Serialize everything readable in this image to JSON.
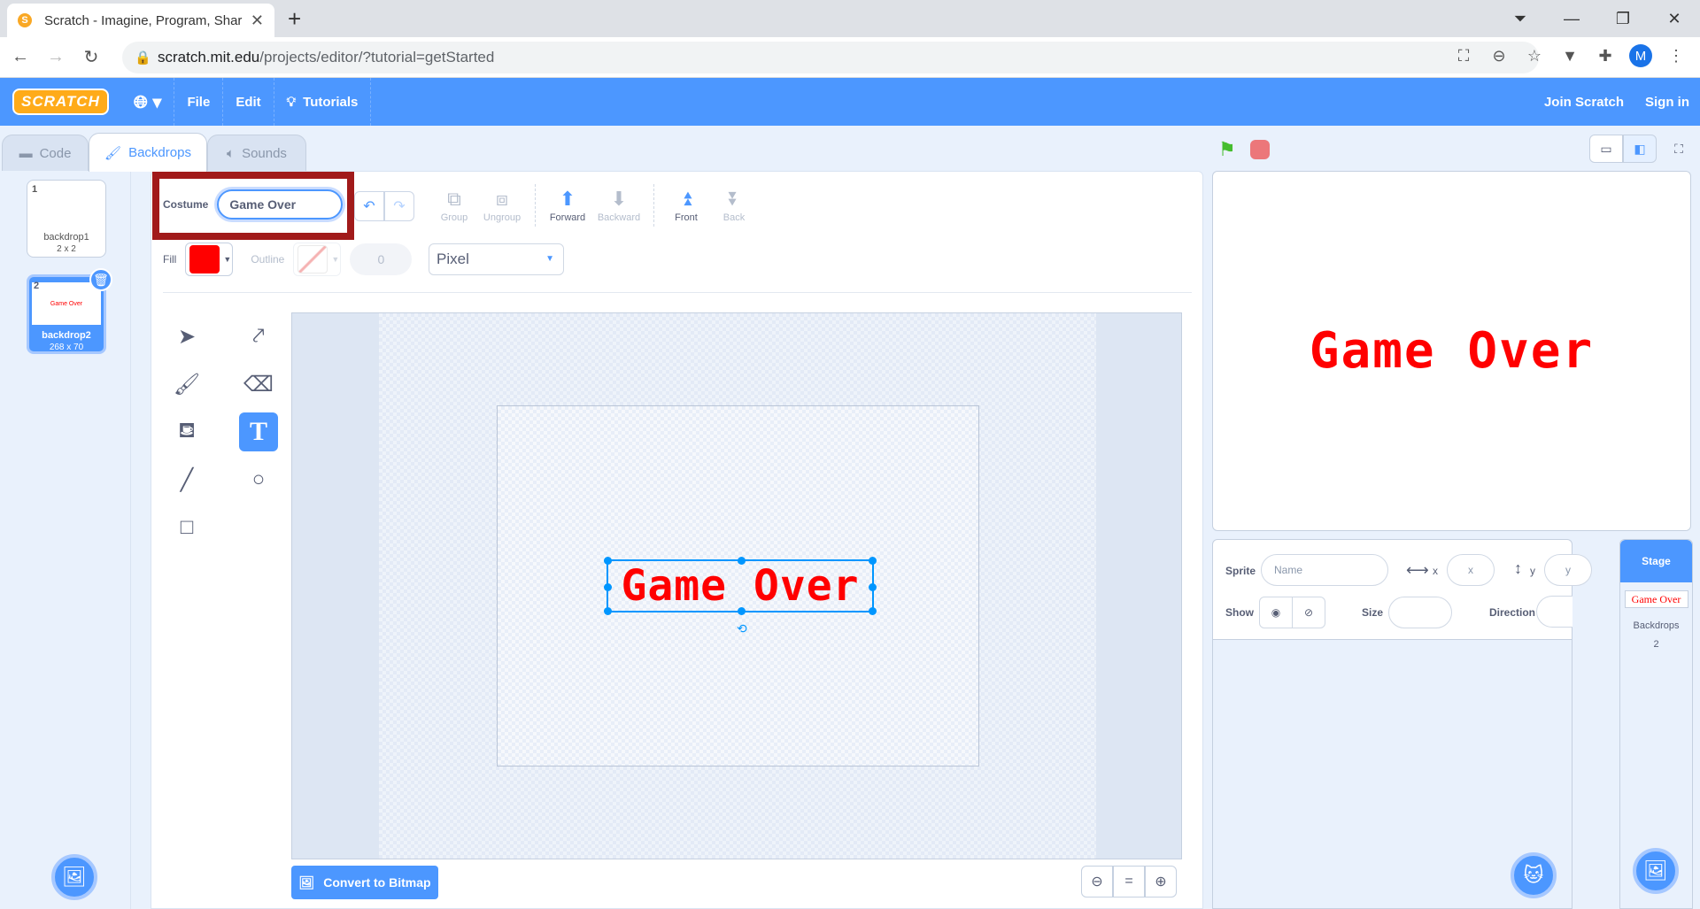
{
  "browser": {
    "tab_title": "Scratch - Imagine, Program, Shar",
    "url_domain": "scratch.mit.edu",
    "url_path": "/projects/editor/?tutorial=getStarted",
    "profile_initial": "M"
  },
  "menubar": {
    "logo": "SCRATCH",
    "file": "File",
    "edit": "Edit",
    "tutorials": "Tutorials",
    "join": "Join Scratch",
    "signin": "Sign in"
  },
  "editor_tabs": {
    "code": "Code",
    "backdrops": "Backdrops",
    "sounds": "Sounds"
  },
  "backdrops": [
    {
      "num": "1",
      "name": "backdrop1",
      "size": "2 x 2"
    },
    {
      "num": "2",
      "name": "backdrop2",
      "size": "268 x 70",
      "preview": "Game Over"
    }
  ],
  "paint": {
    "costume_label": "Costume",
    "costume_name": "Game Over",
    "group": "Group",
    "ungroup": "Ungroup",
    "forward": "Forward",
    "backward": "Backward",
    "front": "Front",
    "back": "Back",
    "fill_label": "Fill",
    "fill_color": "#ff0000",
    "outline_label": "Outline",
    "outline_width": "0",
    "font": "Pixel",
    "canvas_text": "Game Over",
    "convert": "Convert to Bitmap",
    "zoom_reset": "="
  },
  "stage": {
    "text": "Game Over"
  },
  "sprite_info": {
    "sprite_label": "Sprite",
    "name_placeholder": "Name",
    "x_label": "x",
    "x_placeholder": "x",
    "y_label": "y",
    "y_placeholder": "y",
    "show_label": "Show",
    "size_label": "Size",
    "direction_label": "Direction"
  },
  "stage_target": {
    "label": "Stage",
    "thumb_text": "Game Over",
    "backdrops_label": "Backdrops",
    "backdrops_count": "2"
  }
}
